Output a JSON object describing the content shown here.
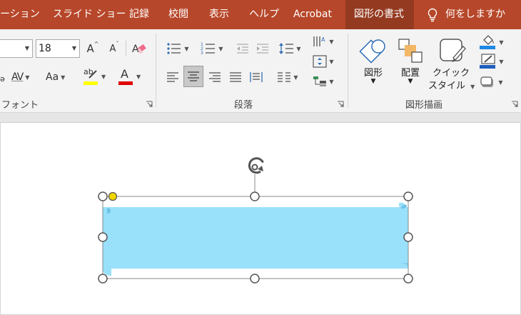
{
  "tabs": [
    {
      "label": "ーション"
    },
    {
      "label": "スライド ショー"
    },
    {
      "label": "記録"
    },
    {
      "label": "校閲"
    },
    {
      "label": "表示"
    },
    {
      "label": "ヘルプ"
    },
    {
      "label": "Acrobat"
    },
    {
      "label": "図形の書式"
    }
  ],
  "help": {
    "icon": "lightbulb-icon",
    "label": "何をしますか"
  },
  "font": {
    "size_value": "18",
    "increase_label": "A",
    "decrease_label": "A",
    "spacing_label": "AV",
    "case_label": "Aa",
    "highlight_label": "ab",
    "color_label": "A",
    "group_label": "フォント",
    "highlight_color": "#ffff00",
    "font_color": "#e00000"
  },
  "paragraph": {
    "group_label": "段落"
  },
  "drawing": {
    "group_label": "図形描画",
    "shape_label": "図形",
    "arrange_label": "配置",
    "quick_style_line1": "クイック",
    "quick_style_line2": "スタイル",
    "fill_color": "#1e88e5",
    "outline_color": "#1f5fbf"
  },
  "slide": {
    "shape_fill": "#99e0fb",
    "handle_color": "#ffffff",
    "adjust_handle_color": "#f2d600"
  }
}
